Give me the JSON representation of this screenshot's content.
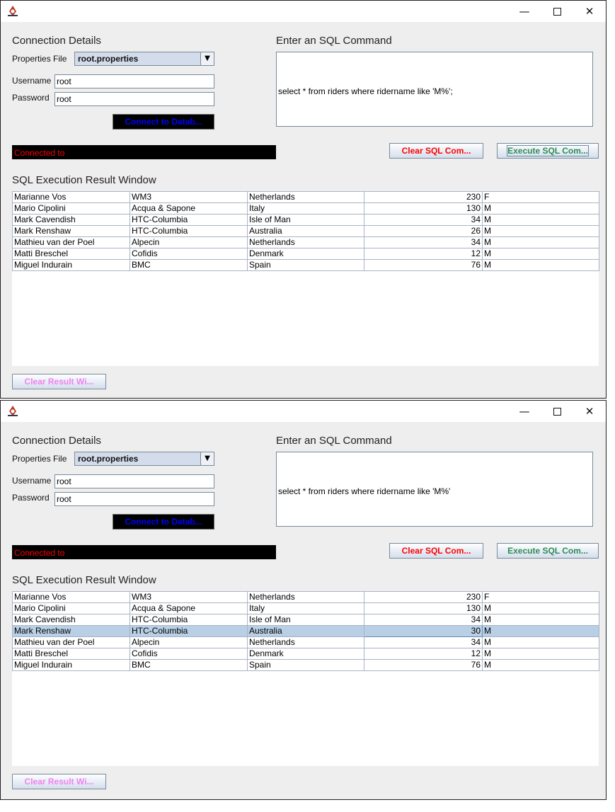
{
  "windows": [
    {
      "connection_heading": "Connection Details",
      "properties_label": "Properties File",
      "properties_value": "root.properties",
      "username_label": "Username",
      "username_value": "root",
      "password_label": "Password",
      "password_value": "root",
      "connect_button": "Connect to Datab...",
      "status_text": "Connected to",
      "sql_heading": "Enter an SQL Command",
      "sql_text": "select * from riders where ridername like 'M%';",
      "clear_sql_button": "Clear SQL Com...",
      "execute_sql_button": "Execute SQL Com...",
      "result_heading": "SQL Execution Result Window",
      "rows": [
        [
          "Marianne Vos",
          "WM3",
          "Netherlands",
          "230",
          "F"
        ],
        [
          "Mario Cipolini",
          "Acqua & Sapone",
          "Italy",
          "130",
          "M"
        ],
        [
          "Mark Cavendish",
          "HTC-Columbia",
          "Isle of Man",
          "34",
          "M"
        ],
        [
          "Mark Renshaw",
          "HTC-Columbia",
          "Australia",
          "26",
          "M"
        ],
        [
          "Mathieu van der Poel",
          "Alpecin",
          "Netherlands",
          "34",
          "M"
        ],
        [
          "Matti Breschel",
          "Cofidis",
          "Denmark",
          "12",
          "M"
        ],
        [
          "Miguel Indurain",
          "BMC",
          "Spain",
          "76",
          "M"
        ]
      ],
      "selected_row": -1,
      "clear_result_button": "Clear Result Wi..."
    },
    {
      "connection_heading": "Connection Details",
      "properties_label": "Properties File",
      "properties_value": "root.properties",
      "username_label": "Username",
      "username_value": "root",
      "password_label": "Password",
      "password_value": "root",
      "connect_button": "Connect to Datab...",
      "status_text": "Connected to",
      "sql_heading": "Enter an SQL Command",
      "sql_text": "select * from riders where ridername like 'M%'",
      "clear_sql_button": "Clear SQL Com...",
      "execute_sql_button": "Execute SQL Com...",
      "result_heading": "SQL Execution Result Window",
      "rows": [
        [
          "Marianne Vos",
          "WM3",
          "Netherlands",
          "230",
          "F"
        ],
        [
          "Mario Cipolini",
          "Acqua & Sapone",
          "Italy",
          "130",
          "M"
        ],
        [
          "Mark Cavendish",
          "HTC-Columbia",
          "Isle of Man",
          "34",
          "M"
        ],
        [
          "Mark Renshaw",
          "HTC-Columbia",
          "Australia",
          "30",
          "M"
        ],
        [
          "Mathieu van der Poel",
          "Alpecin",
          "Netherlands",
          "34",
          "M"
        ],
        [
          "Matti Breschel",
          "Cofidis",
          "Denmark",
          "12",
          "M"
        ],
        [
          "Miguel Indurain",
          "BMC",
          "Spain",
          "76",
          "M"
        ]
      ],
      "selected_row": 3,
      "clear_result_button": "Clear Result Wi..."
    }
  ],
  "title_controls": {
    "minimize": "—",
    "maximize": "",
    "close": "✕"
  },
  "colors": {
    "connect_text": "#0000ff",
    "status_text": "#ff0000",
    "clear_sql": "#ff0000",
    "execute_sql": "#2e8b57",
    "clear_result": "#ee82ee",
    "selection": "#b8cfe5"
  }
}
